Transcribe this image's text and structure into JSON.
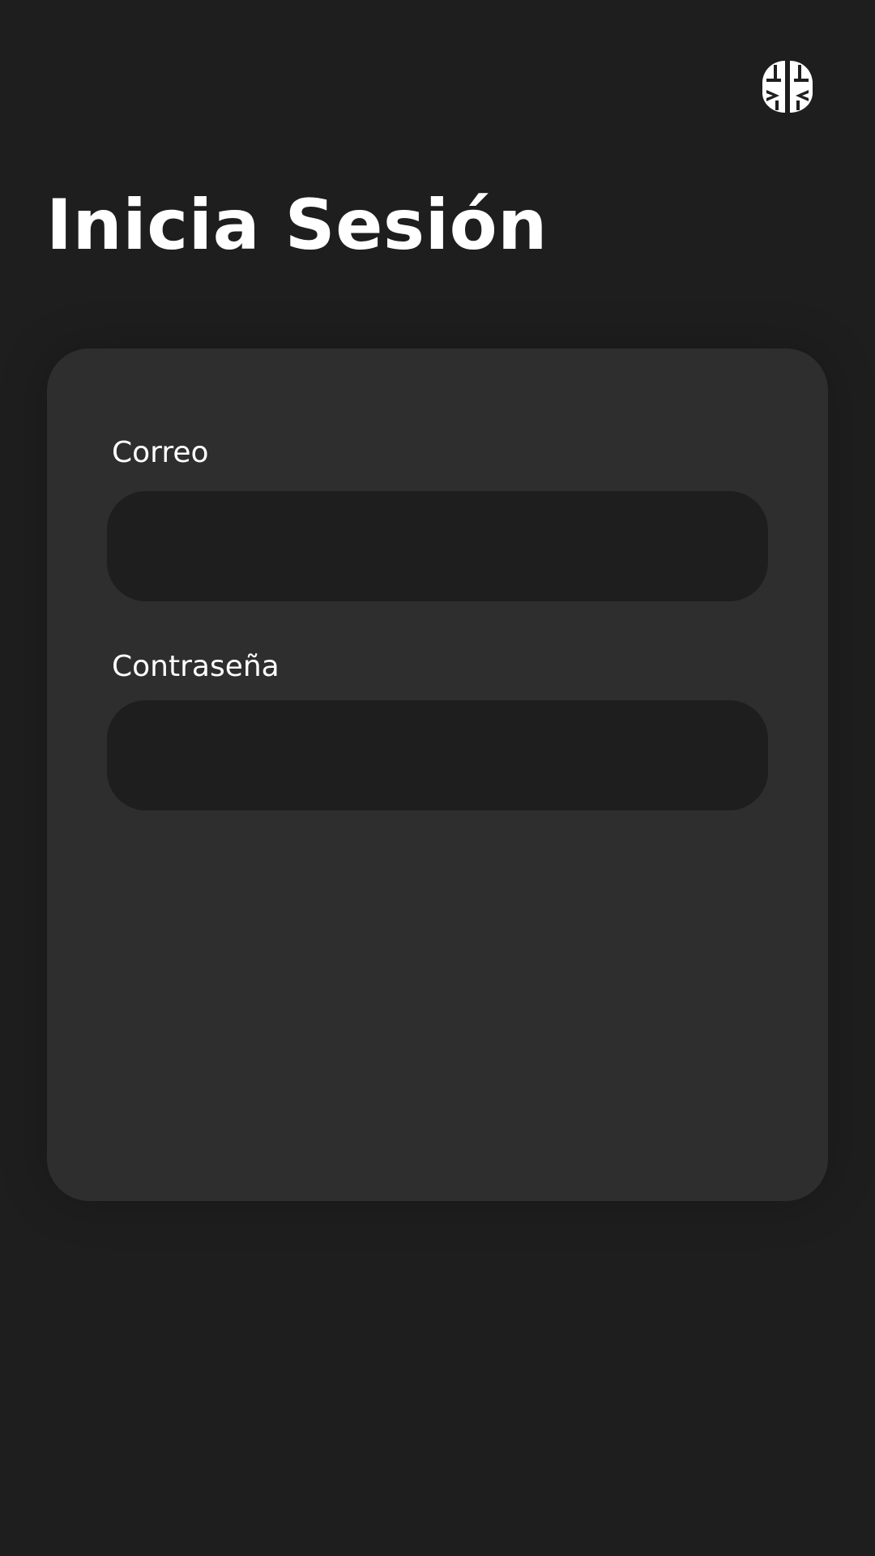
{
  "header": {
    "logo_icon": "brain-icon",
    "title": "Inicia Sesión"
  },
  "form": {
    "email": {
      "label": "Correo",
      "value": "",
      "placeholder": ""
    },
    "password": {
      "label": "Contraseña",
      "value": "",
      "placeholder": ""
    }
  },
  "colors": {
    "background": "#1e1e1e",
    "card": "#2e2e2e",
    "input": "#1e1e1e",
    "text": "#ffffff"
  }
}
